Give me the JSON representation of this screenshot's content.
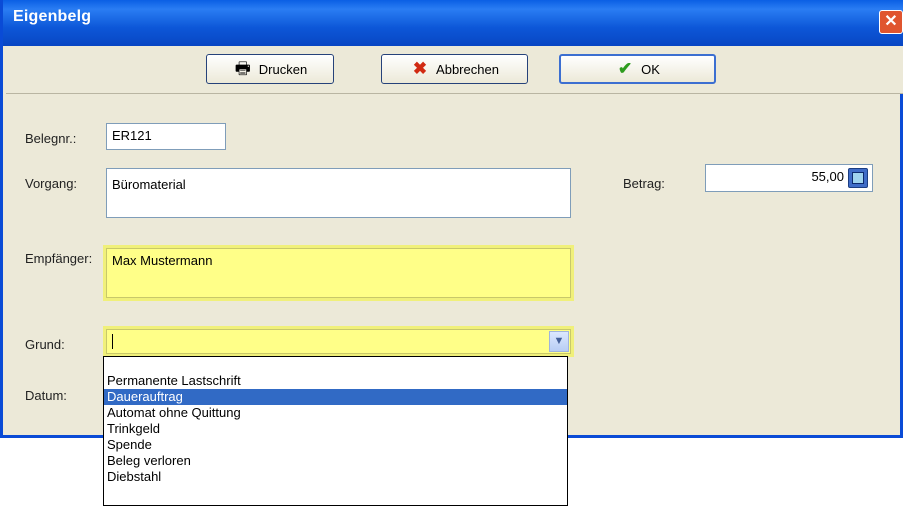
{
  "window": {
    "title": "Eigenbelg",
    "close_symbol": "✕"
  },
  "toolbar": {
    "print_label": "Drucken",
    "cancel_label": "Abbrechen",
    "ok_label": "OK"
  },
  "form": {
    "belegnr_label": "Belegnr.:",
    "belegnr_value": "ER121",
    "vorgang_label": "Vorgang:",
    "vorgang_value": "Büromaterial",
    "betrag_label": "Betrag:",
    "betrag_value": "55,00",
    "empfaenger_label": "Empfänger:",
    "empfaenger_value": "Max Mustermann",
    "grund_label": "Grund:",
    "grund_value": "",
    "datum_label": "Datum:"
  },
  "dropdown": {
    "items": [
      "",
      "Permanente Lastschrift",
      "Dauerauftrag",
      "Automat ohne Quittung",
      "Trinkgeld",
      "Spende",
      "Beleg verloren",
      "Diebstahl"
    ],
    "selected_index": 2
  },
  "colors": {
    "titlebar": "#0a5fe4",
    "highlight_field": "#ffff88",
    "selection": "#316ac5"
  }
}
